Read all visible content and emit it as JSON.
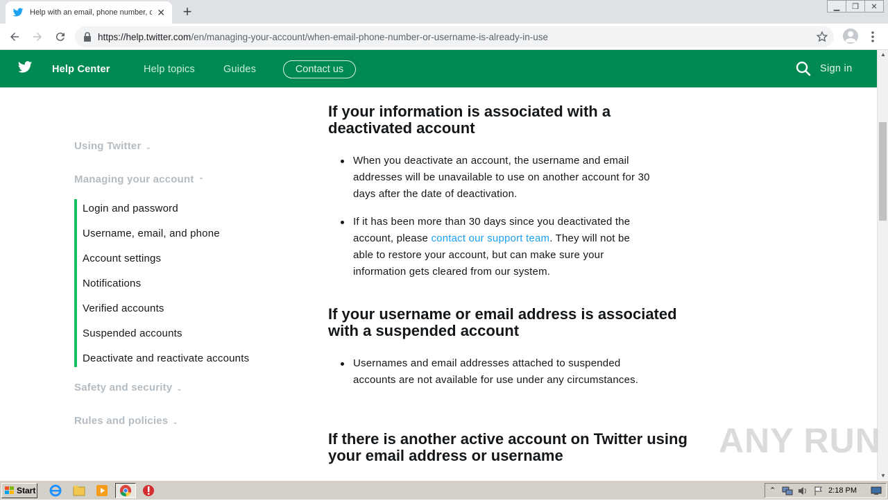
{
  "browser": {
    "tab_title": "Help with an email, phone number, or",
    "url_host": "https://help.twitter.com",
    "url_path": "/en/managing-your-account/when-email-phone-number-or-username-is-already-in-use",
    "new_tab_label": "+",
    "tab_close_label": "✕"
  },
  "site_header": {
    "brand": "Help Center",
    "links": [
      "Help topics",
      "Guides"
    ],
    "contact": "Contact us",
    "signin": "Sign in",
    "bg_color": "#008951"
  },
  "sidebar": {
    "sections": [
      "Using Twitter",
      "Managing your account",
      "Safety and security",
      "Rules and policies"
    ],
    "chevrons": [
      "⌄",
      "⌃",
      "⌄",
      "⌄"
    ],
    "items": [
      "Login and password",
      "Username, email, and phone",
      "Account settings",
      "Notifications",
      "Verified accounts",
      "Suspended accounts",
      "Deactivate and reactivate accounts"
    ],
    "accent_color": "#17bf63"
  },
  "article": {
    "heading1": "If your information is associated with a deactivated account",
    "bullet1": "When you deactivate an account, the username and email addresses will be unavailable to use on another account for 30 days after the date of deactivation.",
    "bullet2_pre": "If it has been more than 30 days since you deactivated the account, please ",
    "bullet2_link": "contact our support team",
    "bullet2_post": ". They will not be able to restore your account, but can make sure your information gets cleared from our system.",
    "heading2": "If your username or email address is associated with a suspended account",
    "bullet3": "Usernames and email addresses attached to suspended accounts are not available for use under any circumstances.",
    "heading3": "If there is another active account on Twitter using your email address or username",
    "link_color": "#1da1f2"
  },
  "watermark": "ANY RUN",
  "taskbar": {
    "start_label": "Start",
    "clock": "2:18 PM"
  }
}
